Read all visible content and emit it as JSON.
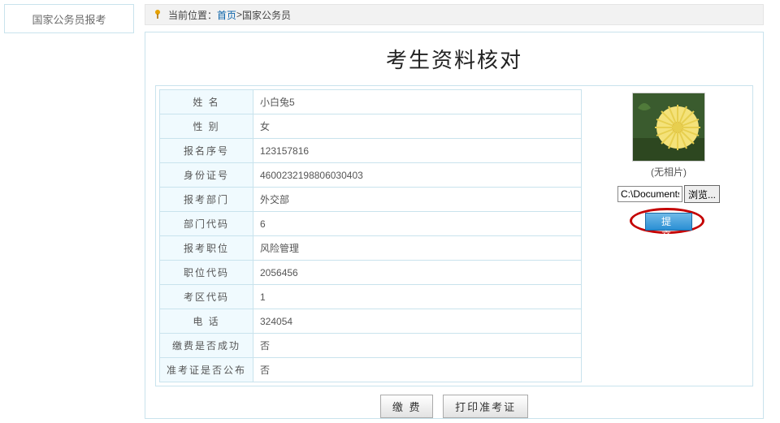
{
  "sidebar": {
    "title": "国家公务员报考"
  },
  "breadcrumb": {
    "prefix": "当前位置：",
    "home": "首页",
    "separator": " >",
    "current": "国家公务员"
  },
  "title": "考生资料核对",
  "fields": {
    "name_label": "姓 名",
    "name": "小白兔5",
    "gender_label": "性 别",
    "gender": "女",
    "reg_no_label": "报名序号",
    "reg_no": "123157816",
    "id_no_label": "身份证号",
    "id_no": "4600232198806030403",
    "dept_label": "报考部门",
    "dept": "外交部",
    "dept_code_label": "部门代码",
    "dept_code": "6",
    "position_label": "报考职位",
    "position": "风险管理",
    "position_code_label": "职位代码",
    "position_code": "2056456",
    "area_code_label": "考区代码",
    "area_code": "1",
    "phone_label": "电 话",
    "phone": "324054",
    "paid_label": "缴费是否成功",
    "paid": "否",
    "ticket_label": "准考证是否公布",
    "ticket": "否"
  },
  "photo": {
    "caption": "(无相片)",
    "file_path_value": "C:\\Documents :",
    "browse_label": "浏览...",
    "submit_label": "提 交"
  },
  "buttons": {
    "pay": "缴 费",
    "print_ticket": "打印准考证"
  }
}
